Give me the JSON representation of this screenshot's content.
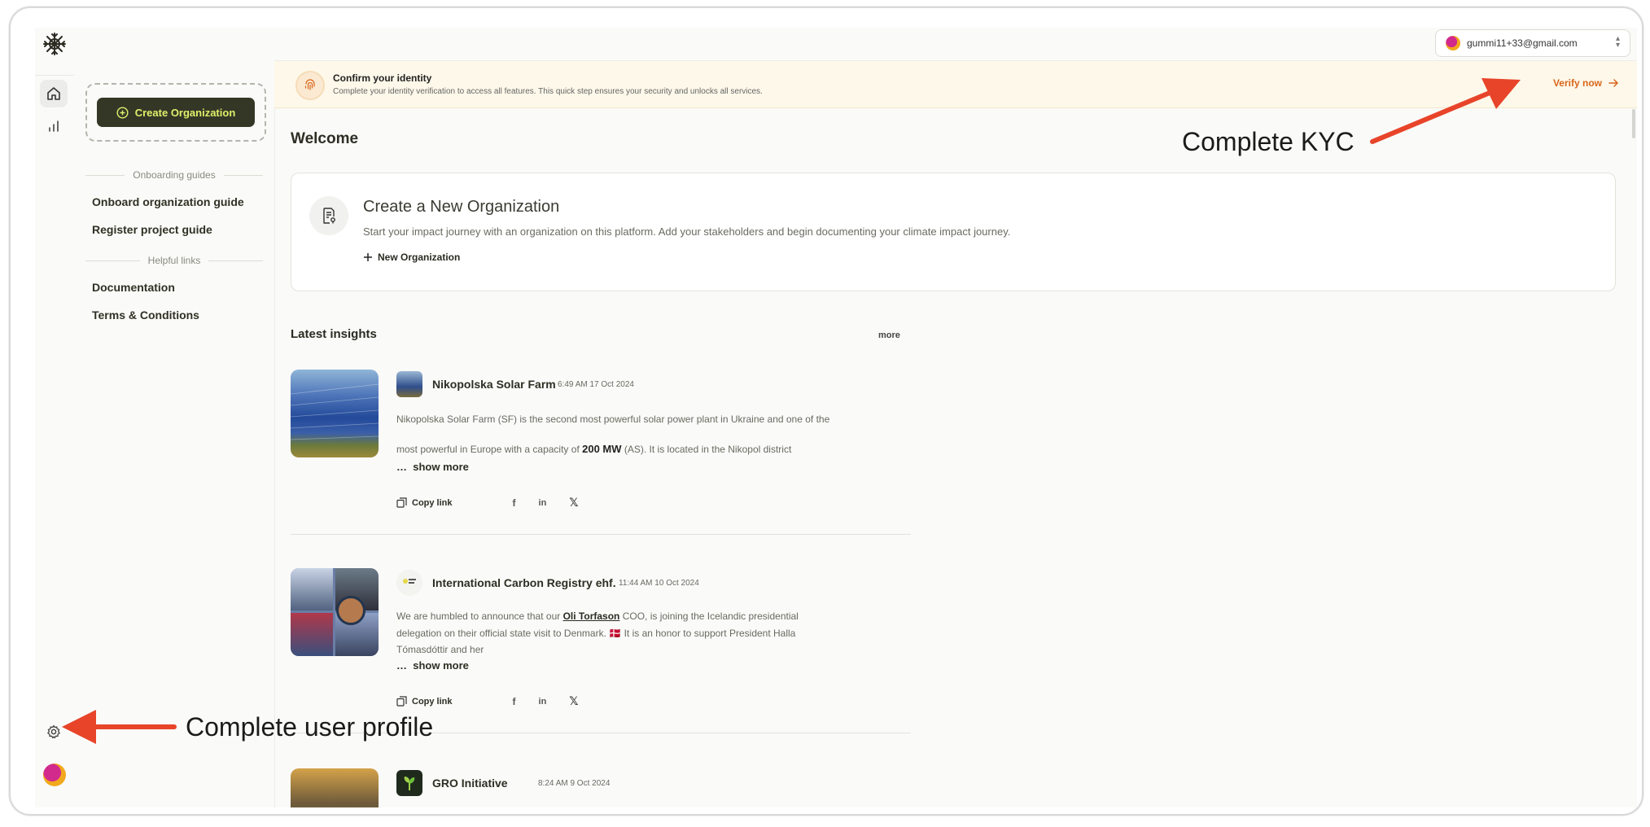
{
  "account": {
    "email": "gummi11+33@gmail.com"
  },
  "sidebar": {
    "create_label": "Create Organization",
    "onboarding_heading": "Onboarding guides",
    "onboarding_links": [
      "Onboard organization guide",
      "Register project guide"
    ],
    "helpful_heading": "Helpful links",
    "helpful_links": [
      "Documentation",
      "Terms & Conditions"
    ]
  },
  "banner": {
    "title": "Confirm your identity",
    "subtitle": "Complete your identity verification to access all features. This quick step ensures your security and unlocks all services.",
    "cta": "Verify now"
  },
  "main": {
    "welcome": "Welcome",
    "card": {
      "title": "Create a New Organization",
      "subtitle": "Start your impact journey with an organization on this platform. Add your stakeholders and begin documenting your climate impact journey.",
      "action": "New Organization"
    },
    "insights_title": "Latest insights",
    "more_label": "more",
    "posts": [
      {
        "name": "Nikopolska Solar Farm",
        "time": "6:49 AM 17 Oct 2024",
        "text_a": "Nikopolska Solar Farm (SF) is the second most powerful solar power plant in Ukraine and one of the",
        "text_b": "most powerful in Europe with a capacity of",
        "text_bold": "200 MW",
        "text_c": "(AS). It is located in the Nikopol district",
        "show_more": "show more",
        "copy_link": "Copy link"
      },
      {
        "name": "International Carbon Registry ehf.",
        "time": "11:44 AM 10 Oct 2024",
        "text_a": "We are humbled to announce that our",
        "text_link": "Oli Torfason",
        "text_b": "COO, is joining the Icelandic presidential",
        "text_c": "delegation on their official state visit to Denmark.",
        "text_tag": "🇩🇰",
        "text_d": "It is an honor to support President Halla",
        "text_e": "Tómasdóttir and her",
        "show_more": "show more",
        "copy_link": "Copy link"
      },
      {
        "name": "GRO Initiative",
        "time": "8:24 AM 9 Oct 2024"
      }
    ]
  },
  "annotations": {
    "kyc": "Complete KYC",
    "profile": "Complete user profile"
  },
  "colors": {
    "accent": "#d9661a",
    "brand_dark": "#353726",
    "brand_lime": "#dff06a",
    "annotation_arrow": "#e8442a"
  }
}
